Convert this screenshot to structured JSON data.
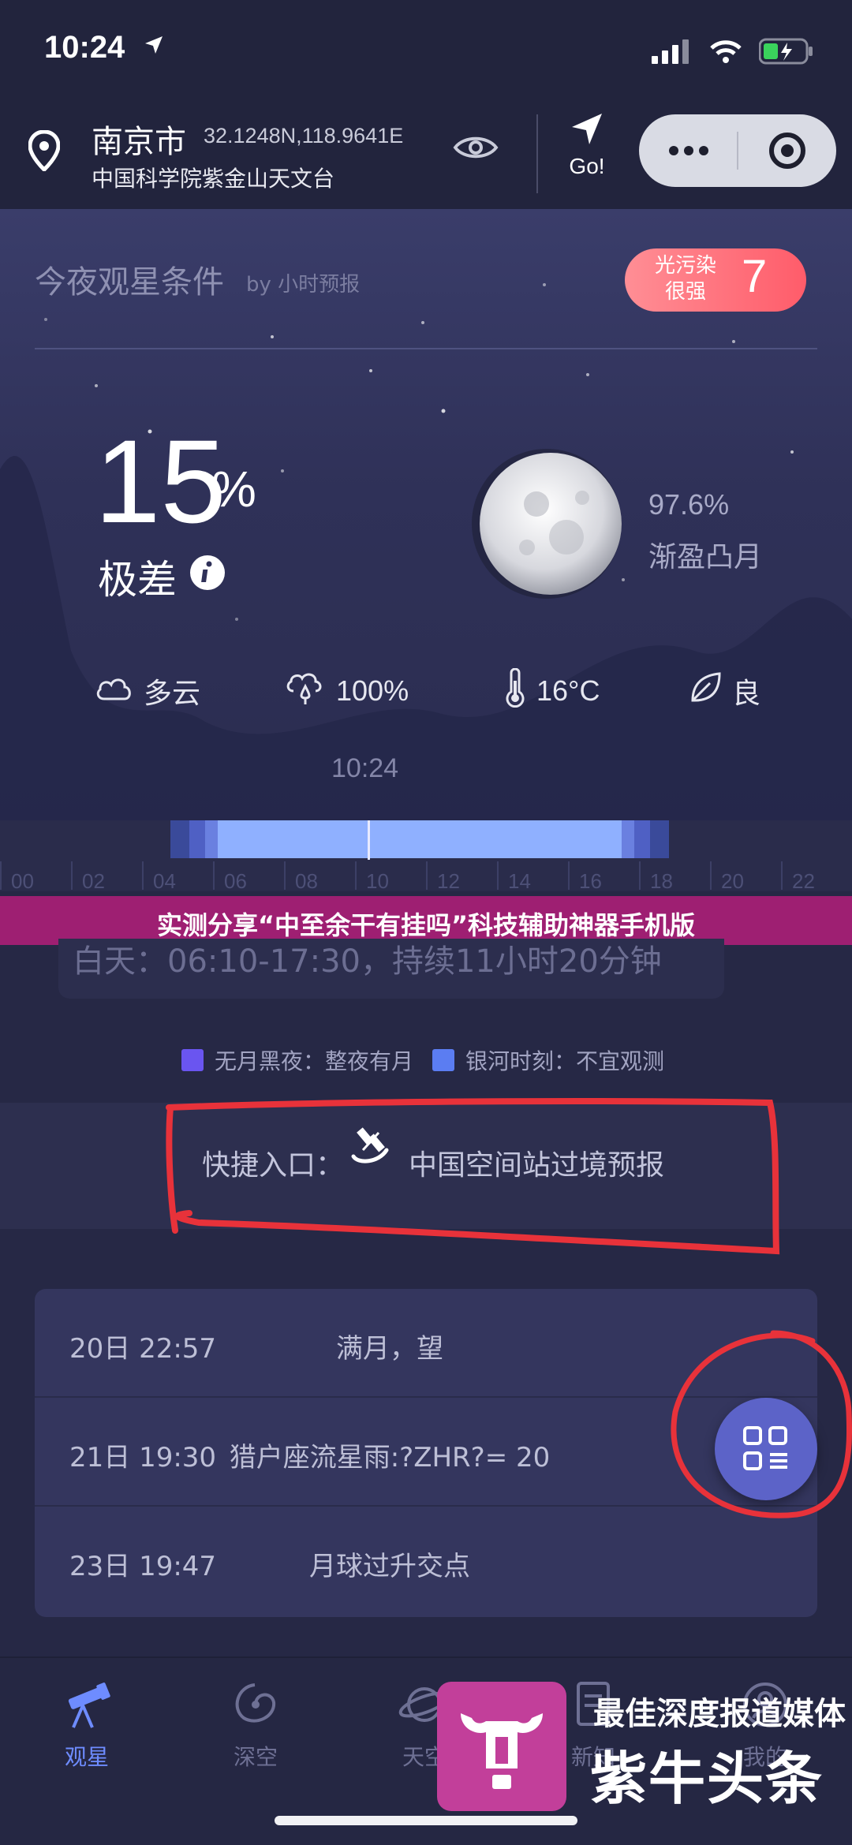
{
  "status_bar": {
    "time": "10:24"
  },
  "header": {
    "city": "南京市",
    "coordinates": "32.1248N,118.9641E",
    "observatory": "中国科学院紫金山天文台",
    "go_label": "Go!"
  },
  "sky": {
    "section_title": "今夜观星条件",
    "section_subtitle": "by 小时预报",
    "pollution": {
      "label": "光污染很强",
      "value": "7"
    },
    "index_value": "15",
    "index_unit": "%",
    "quality": "极差",
    "moon": {
      "illumination": "97.6%",
      "phase": "渐盈凸月"
    },
    "weather": [
      {
        "icon": "cloud-icon",
        "text": "多云"
      },
      {
        "icon": "humidity-icon",
        "text": "100%"
      },
      {
        "icon": "thermometer-icon",
        "text": "16°C"
      },
      {
        "icon": "leaf-icon",
        "text": "良"
      }
    ],
    "current_time": "10:24"
  },
  "timeline": {
    "ticks": [
      "00",
      "02",
      "04",
      "06",
      "08",
      "10",
      "12",
      "14",
      "16",
      "18",
      "20",
      "22"
    ]
  },
  "banner": {
    "title": "实测分享“中至余干有挂吗”科技辅助神器手机版"
  },
  "daylight": "白天：06:10-17:30，持续11小时20分钟",
  "legend": [
    {
      "color": "#6a55f0",
      "text": "无月黑夜：整夜有月"
    },
    {
      "color": "#5b7df2",
      "text": "银河时刻：不宜观测"
    }
  ],
  "shortcut": {
    "label": "快捷入口：",
    "link": "中国空间站过境预报"
  },
  "events": [
    {
      "time": "20日 22:57",
      "desc": "满月，望"
    },
    {
      "time": "21日 19:30",
      "desc": "猎户座流星雨:?ZHR?= 20"
    },
    {
      "time": "23日 19:47",
      "desc": "月球过升交点"
    }
  ],
  "tabs": [
    {
      "label": "观星",
      "active": true
    },
    {
      "label": "深空",
      "active": false
    },
    {
      "label": "天空",
      "active": false
    },
    {
      "label": "新知",
      "active": false
    },
    {
      "label": "我的",
      "active": false
    }
  ],
  "watermark": {
    "tagline": "最佳深度报道媒体",
    "brand": "紫牛头条"
  },
  "colors": {
    "accent": "#6e8cff",
    "pollution": "#ff6b77",
    "banner": "#9e1f72",
    "annotation": "#e8323a"
  }
}
